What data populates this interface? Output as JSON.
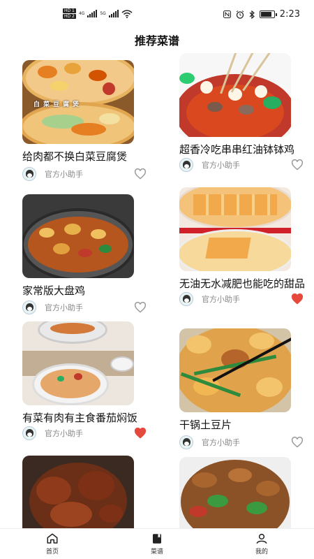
{
  "status_bar": {
    "sim1": "HD 1",
    "sim2": "HD 2",
    "net1": "4G",
    "net2": "5G",
    "time": "2:23"
  },
  "header": {
    "title": "推荐菜谱"
  },
  "recipes": [
    {
      "title": "给肉都不换白菜豆腐煲",
      "author": "官方小助手",
      "liked": false,
      "image_caption": "白菜豆腐煲"
    },
    {
      "title": "超香冷吃串串红油钵钵鸡",
      "author": "官方小助手",
      "liked": false
    },
    {
      "title": "家常版大盘鸡",
      "author": "官方小助手",
      "liked": false
    },
    {
      "title": "无油无水减肥也能吃的甜品",
      "author": "官方小助手",
      "liked": true
    },
    {
      "title": "有菜有肉有主食番茄焖饭",
      "author": "官方小助手",
      "liked": true
    },
    {
      "title": "干锅土豆片",
      "author": "官方小助手",
      "liked": false
    }
  ],
  "colors": {
    "liked": "#e5483d",
    "unliked": "#999999"
  },
  "bottom_nav": [
    {
      "label": "首页",
      "icon": "home-icon"
    },
    {
      "label": "菜谱",
      "icon": "book-icon"
    },
    {
      "label": "我的",
      "icon": "person-icon"
    }
  ]
}
